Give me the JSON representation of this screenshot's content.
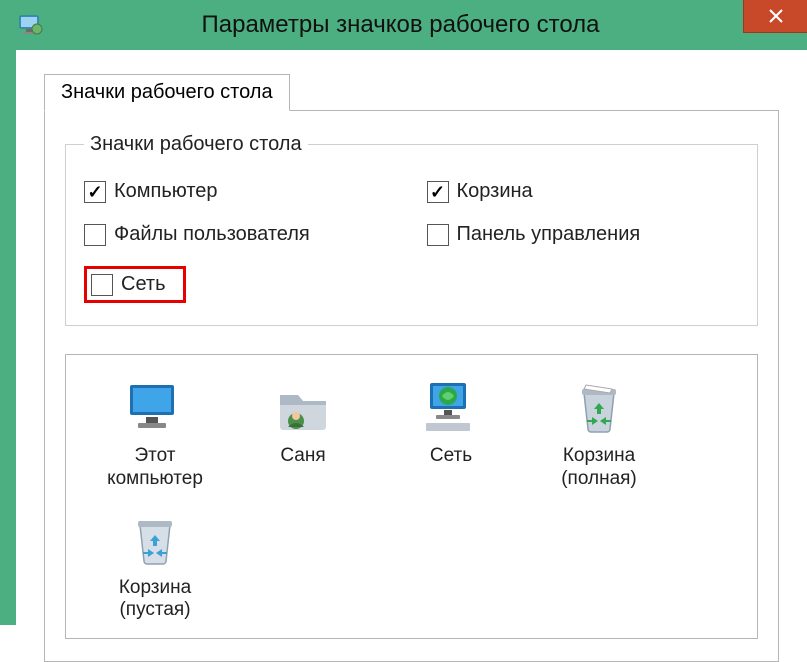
{
  "title": "Параметры значков рабочего стола",
  "close": "Close",
  "tab": {
    "label": "Значки рабочего стола"
  },
  "group": {
    "legend": "Значки рабочего стола",
    "items": [
      {
        "label": "Компьютер",
        "checked": true
      },
      {
        "label": "Корзина",
        "checked": true
      },
      {
        "label": "Файлы пользователя",
        "checked": false
      },
      {
        "label": "Панель управления",
        "checked": false
      },
      {
        "label": "Сеть",
        "checked": false,
        "highlight": true
      }
    ]
  },
  "icons": [
    {
      "label": "Этот компьютер",
      "name": "this-pc"
    },
    {
      "label": "Саня",
      "name": "user-folder"
    },
    {
      "label": "Сеть",
      "name": "network"
    },
    {
      "label": "Корзина (полная)",
      "name": "recycle-full"
    },
    {
      "label": "Корзина (пустая)",
      "name": "recycle-empty"
    }
  ]
}
